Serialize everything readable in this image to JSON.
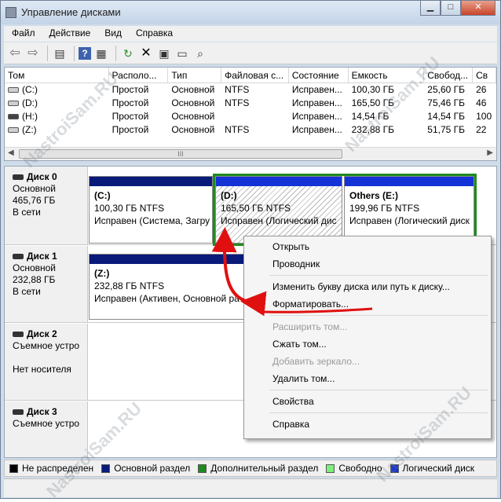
{
  "window": {
    "title": "Управление дисками",
    "buttons": {
      "minimize": "▁",
      "maximize": "□",
      "close": "✕"
    }
  },
  "menu": [
    "Файл",
    "Действие",
    "Вид",
    "Справка"
  ],
  "toolbar": [
    "back-icon",
    "forward-icon",
    "console-tree-icon",
    "help-icon",
    "properties-list-icon",
    "refresh-icon",
    "delete-icon",
    "properties-icon",
    "open-icon",
    "explore-icon"
  ],
  "volumes": {
    "headers": [
      "Том",
      "Располо...",
      "Тип",
      "Файловая с...",
      "Состояние",
      "Емкость",
      "Свобод...",
      "Св"
    ],
    "rows": [
      [
        "(C:)",
        "Простой",
        "Основной",
        "NTFS",
        "Исправен...",
        "100,30 ГБ",
        "25,60 ГБ",
        "26"
      ],
      [
        "(D:)",
        "Простой",
        "Основной",
        "NTFS",
        "Исправен...",
        "165,50 ГБ",
        "75,46 ГБ",
        "46"
      ],
      [
        "(H:)",
        "Простой",
        "Основной",
        "",
        "Исправен...",
        "14,54 ГБ",
        "14,54 ГБ",
        "100"
      ],
      [
        "(Z:)",
        "Простой",
        "Основной",
        "NTFS",
        "Исправен...",
        "232,88 ГБ",
        "51,75 ГБ",
        "22"
      ]
    ],
    "scroll_thumb": "III"
  },
  "disks": [
    {
      "name": "Диск 0",
      "type": "Основной",
      "size": "465,76 ГБ",
      "state": "В сети",
      "partitions": [
        {
          "label": "(C:)",
          "size": "100,30 ГБ NTFS",
          "status": "Исправен (Система, Загру"
        },
        {
          "label": "(D:)",
          "size": "165,50 ГБ NTFS",
          "status": "Исправен (Логический дис"
        },
        {
          "label": "Others  (E:)",
          "size": "199,96 ГБ NTFS",
          "status": "Исправен (Логический диск"
        }
      ]
    },
    {
      "name": "Диск 1",
      "type": "Основной",
      "size": "232,88 ГБ",
      "state": "В сети",
      "partitions": [
        {
          "label": "(Z:)",
          "size": "232,88 ГБ NTFS",
          "status": "Исправен (Активен, Основной ра"
        }
      ]
    },
    {
      "name": "Диск 2",
      "type": "Съемное устро",
      "state": "Нет носителя"
    },
    {
      "name": "Диск 3",
      "type": "Съемное устро"
    }
  ],
  "legend": [
    {
      "label": "Не распределен",
      "color": "#000000"
    },
    {
      "label": "Основной раздел",
      "color": "#0a1a7a"
    },
    {
      "label": "Дополнительный раздел",
      "color": "#1f8a1f"
    },
    {
      "label": "Свободно",
      "color": "#7cf07c"
    },
    {
      "label": "Логический диск",
      "color": "#1433d6"
    }
  ],
  "context_menu": {
    "open": "Открыть",
    "explorer": "Проводник",
    "change_letter": "Изменить букву диска или путь к диску...",
    "format": "Форматировать...",
    "extend": "Расширить том...",
    "shrink": "Сжать том...",
    "add_mirror": "Добавить зеркало...",
    "delete": "Удалить том...",
    "properties": "Свойства",
    "help": "Справка"
  },
  "colors": {
    "primary_bar": "#0a1a7a",
    "logical_bar": "#1433d6",
    "extended_frame": "#1f8a1f",
    "annotation": "#e01010"
  },
  "watermark": "NastroiSam.RU"
}
